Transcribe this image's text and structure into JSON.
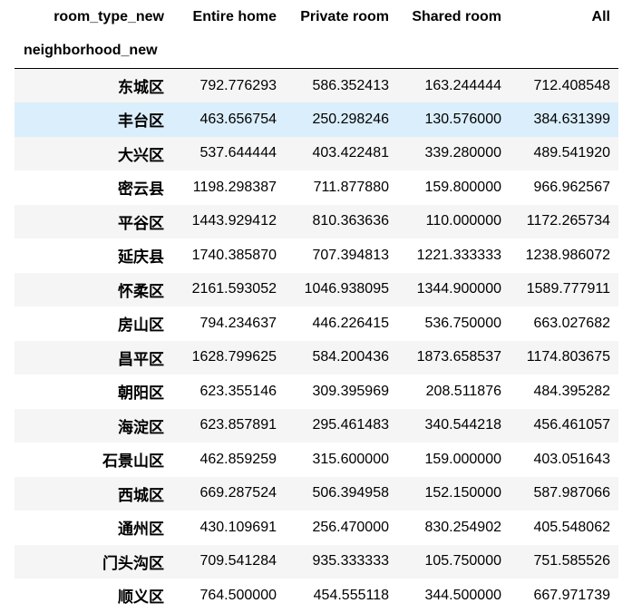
{
  "table": {
    "columns_name": "room_type_new",
    "index_name": "neighborhood_new",
    "columns": [
      "Entire home",
      "Private room",
      "Shared room",
      "All"
    ],
    "hovered_row": 1,
    "rows": [
      {
        "index": "东城区",
        "values": [
          "792.776293",
          "586.352413",
          "163.244444",
          "712.408548"
        ]
      },
      {
        "index": "丰台区",
        "values": [
          "463.656754",
          "250.298246",
          "130.576000",
          "384.631399"
        ]
      },
      {
        "index": "大兴区",
        "values": [
          "537.644444",
          "403.422481",
          "339.280000",
          "489.541920"
        ]
      },
      {
        "index": "密云县",
        "values": [
          "1198.298387",
          "711.877880",
          "159.800000",
          "966.962567"
        ]
      },
      {
        "index": "平谷区",
        "values": [
          "1443.929412",
          "810.363636",
          "110.000000",
          "1172.265734"
        ]
      },
      {
        "index": "延庆县",
        "values": [
          "1740.385870",
          "707.394813",
          "1221.333333",
          "1238.986072"
        ]
      },
      {
        "index": "怀柔区",
        "values": [
          "2161.593052",
          "1046.938095",
          "1344.900000",
          "1589.777911"
        ]
      },
      {
        "index": "房山区",
        "values": [
          "794.234637",
          "446.226415",
          "536.750000",
          "663.027682"
        ]
      },
      {
        "index": "昌平区",
        "values": [
          "1628.799625",
          "584.200436",
          "1873.658537",
          "1174.803675"
        ]
      },
      {
        "index": "朝阳区",
        "values": [
          "623.355146",
          "309.395969",
          "208.511876",
          "484.395282"
        ]
      },
      {
        "index": "海淀区",
        "values": [
          "623.857891",
          "295.461483",
          "340.544218",
          "456.461057"
        ]
      },
      {
        "index": "石景山区",
        "values": [
          "462.859259",
          "315.600000",
          "159.000000",
          "403.051643"
        ]
      },
      {
        "index": "西城区",
        "values": [
          "669.287524",
          "506.394958",
          "152.150000",
          "587.987066"
        ]
      },
      {
        "index": "通州区",
        "values": [
          "430.109691",
          "256.470000",
          "830.254902",
          "405.548062"
        ]
      },
      {
        "index": "门头沟区",
        "values": [
          "709.541284",
          "935.333333",
          "105.750000",
          "751.585526"
        ]
      },
      {
        "index": "顺义区",
        "values": [
          "764.500000",
          "454.555118",
          "344.500000",
          "667.971739"
        ]
      }
    ]
  }
}
